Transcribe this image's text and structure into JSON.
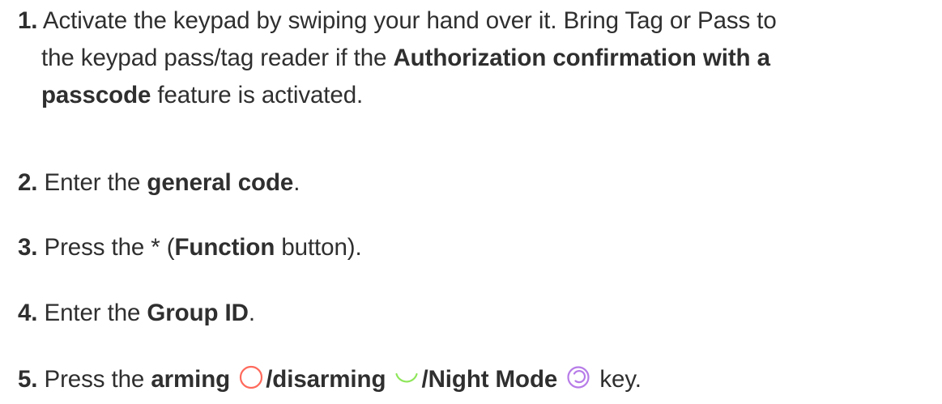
{
  "steps": [
    {
      "num": "1.",
      "line1": "Activate the keypad by swiping your hand over it. Bring Tag or Pass to",
      "line2_pre": "the keypad pass/tag reader if the ",
      "line2_bold": "Authorization confirmation with a",
      "line3_bold": "passcode",
      "line3_post": " feature is activated."
    },
    {
      "num": "2.",
      "pre": " Enter the ",
      "bold": "general code",
      "post": "."
    },
    {
      "num": "3.",
      "pre": " Press the * (",
      "bold": "Function",
      "post": " button)."
    },
    {
      "num": "4.",
      "pre": " Enter the ",
      "bold": "Group ID",
      "post": "."
    },
    {
      "num": "5.",
      "pre": " Press the ",
      "bold_arming": "arming",
      "sep1": "/",
      "bold_disarming": "disarming",
      "sep2": "/",
      "bold_night": "Night Mode",
      "post": " key."
    }
  ],
  "icons": {
    "arming": {
      "name": "arming-icon",
      "color": "#ff6a5c"
    },
    "disarming": {
      "name": "disarming-icon",
      "color": "#8ee65a"
    },
    "night": {
      "name": "night-mode-icon",
      "color": "#b77ce8"
    }
  }
}
